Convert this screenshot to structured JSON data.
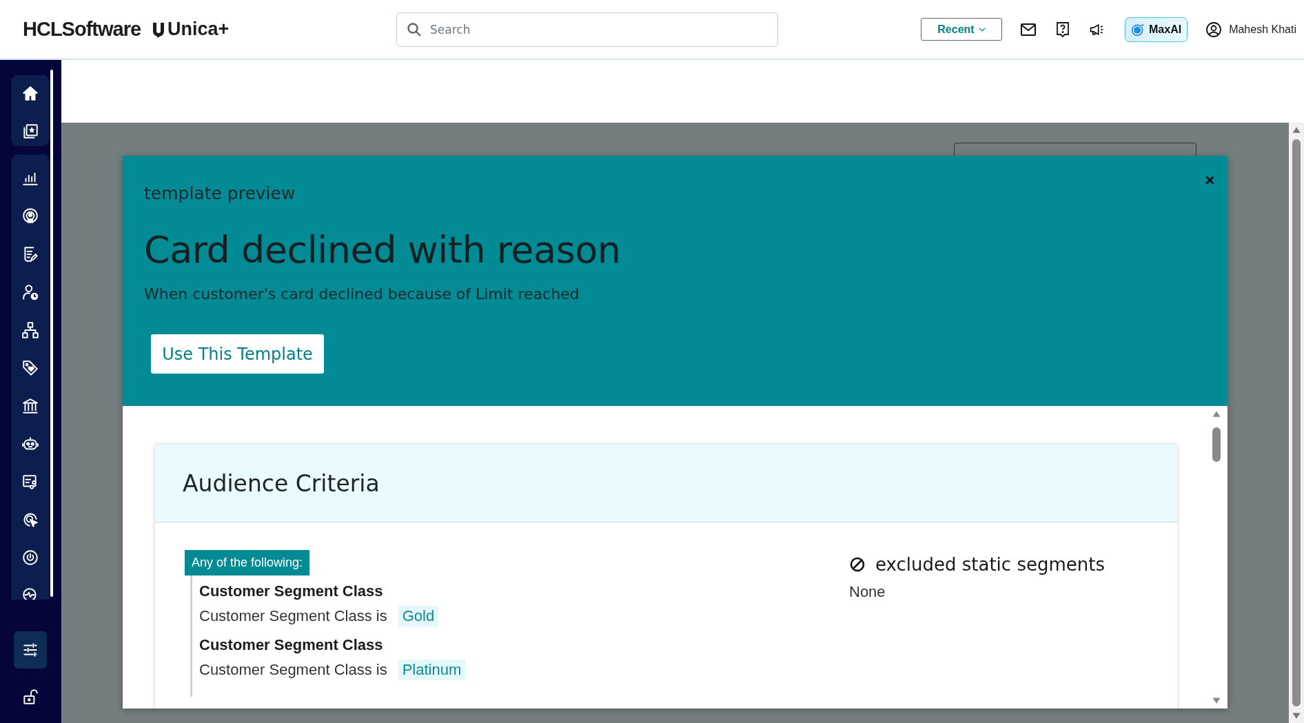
{
  "header": {
    "logo": "HCLSoftware",
    "product": "Unica+",
    "search": {
      "placeholder": "Search"
    },
    "recent_button": "Recent",
    "maxai_button": "MaxAI",
    "user": "Mahesh Khati"
  },
  "sidebar": {
    "top": [
      {
        "kind": "home"
      },
      {
        "kind": "gallery"
      }
    ],
    "main": [
      {
        "kind": "chart"
      },
      {
        "kind": "broadcast"
      },
      {
        "kind": "document"
      },
      {
        "kind": "user-clock"
      },
      {
        "kind": "hierarchy"
      },
      {
        "kind": "tag"
      },
      {
        "kind": "bank"
      },
      {
        "kind": "robot"
      },
      {
        "kind": "flow"
      },
      {
        "kind": "target"
      },
      {
        "kind": "power"
      },
      {
        "kind": "analytics"
      }
    ],
    "bottom": [
      {
        "kind": "sliders",
        "selected": true
      },
      {
        "kind": "unlock",
        "selected": false
      }
    ]
  },
  "modal": {
    "label": "template preview",
    "title": "Card declined with reason",
    "description": "When customer's card declined because of Limit reached",
    "use_button": "Use This Template",
    "card": {
      "title": "Audience Criteria",
      "group_label": "Any of the following:",
      "conditions": [
        {
          "field": "Customer Segment Class",
          "text": "Customer Segment Class is",
          "value": "Gold"
        },
        {
          "field": "Customer Segment Class",
          "text": "Customer Segment Class is",
          "value": "Platinum"
        }
      ],
      "excluded": {
        "title": "excluded static segments",
        "value": "None"
      }
    }
  }
}
